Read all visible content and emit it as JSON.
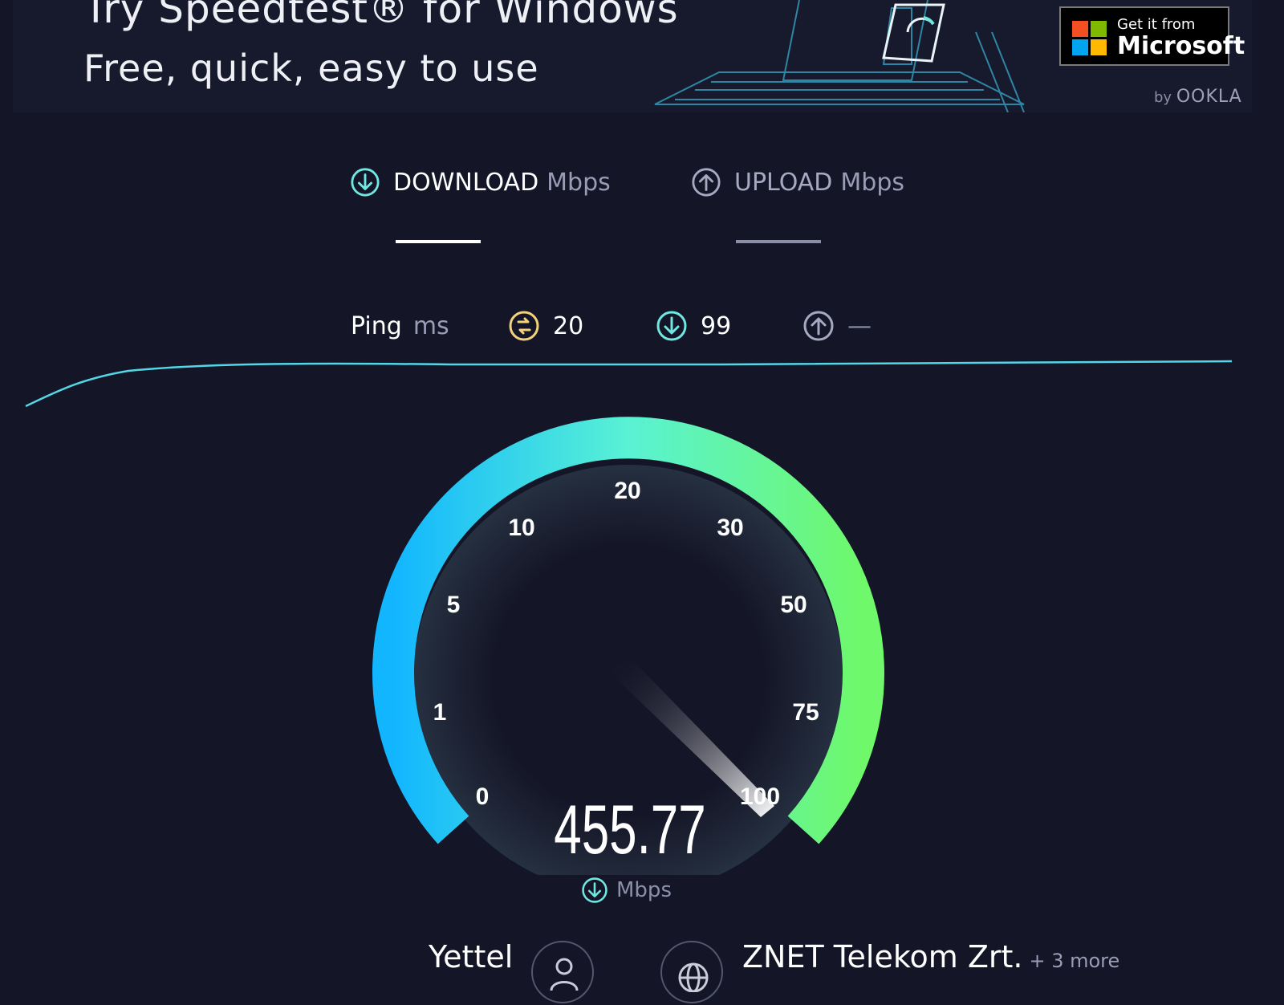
{
  "banner": {
    "title": "Try Speedtest® for Windows",
    "subtitle": "Free, quick, easy to use",
    "store_badge": {
      "line1": "Get it from",
      "line2": "Microsoft"
    },
    "by": "by",
    "brand": "OOKLA"
  },
  "tabs": {
    "download": {
      "title": "DOWNLOAD",
      "unit": "Mbps"
    },
    "upload": {
      "title": "UPLOAD",
      "unit": "Mbps"
    }
  },
  "ping": {
    "label": "Ping",
    "unit": "ms",
    "idle": "20",
    "download": "99",
    "upload": "—"
  },
  "gauge": {
    "ticks": [
      "0",
      "1",
      "5",
      "10",
      "20",
      "30",
      "50",
      "75",
      "100"
    ],
    "reading": "455.77",
    "unit": "Mbps"
  },
  "connection": {
    "provider": "Yettel",
    "server": "ZNET Telekom Zrt.",
    "more": "+ 3 more"
  },
  "colors": {
    "background": "#141526",
    "accent": "#6fe8e2",
    "ping_idle": "#f4d27a",
    "gauge_start": "#12b6ff",
    "gauge_end": "#6ff86a"
  },
  "icons": {
    "download": "arrow-down-circle-icon",
    "upload": "arrow-up-circle-icon",
    "ping": "ping-circle-icon",
    "provider": "user-icon",
    "server": "globe-icon"
  }
}
